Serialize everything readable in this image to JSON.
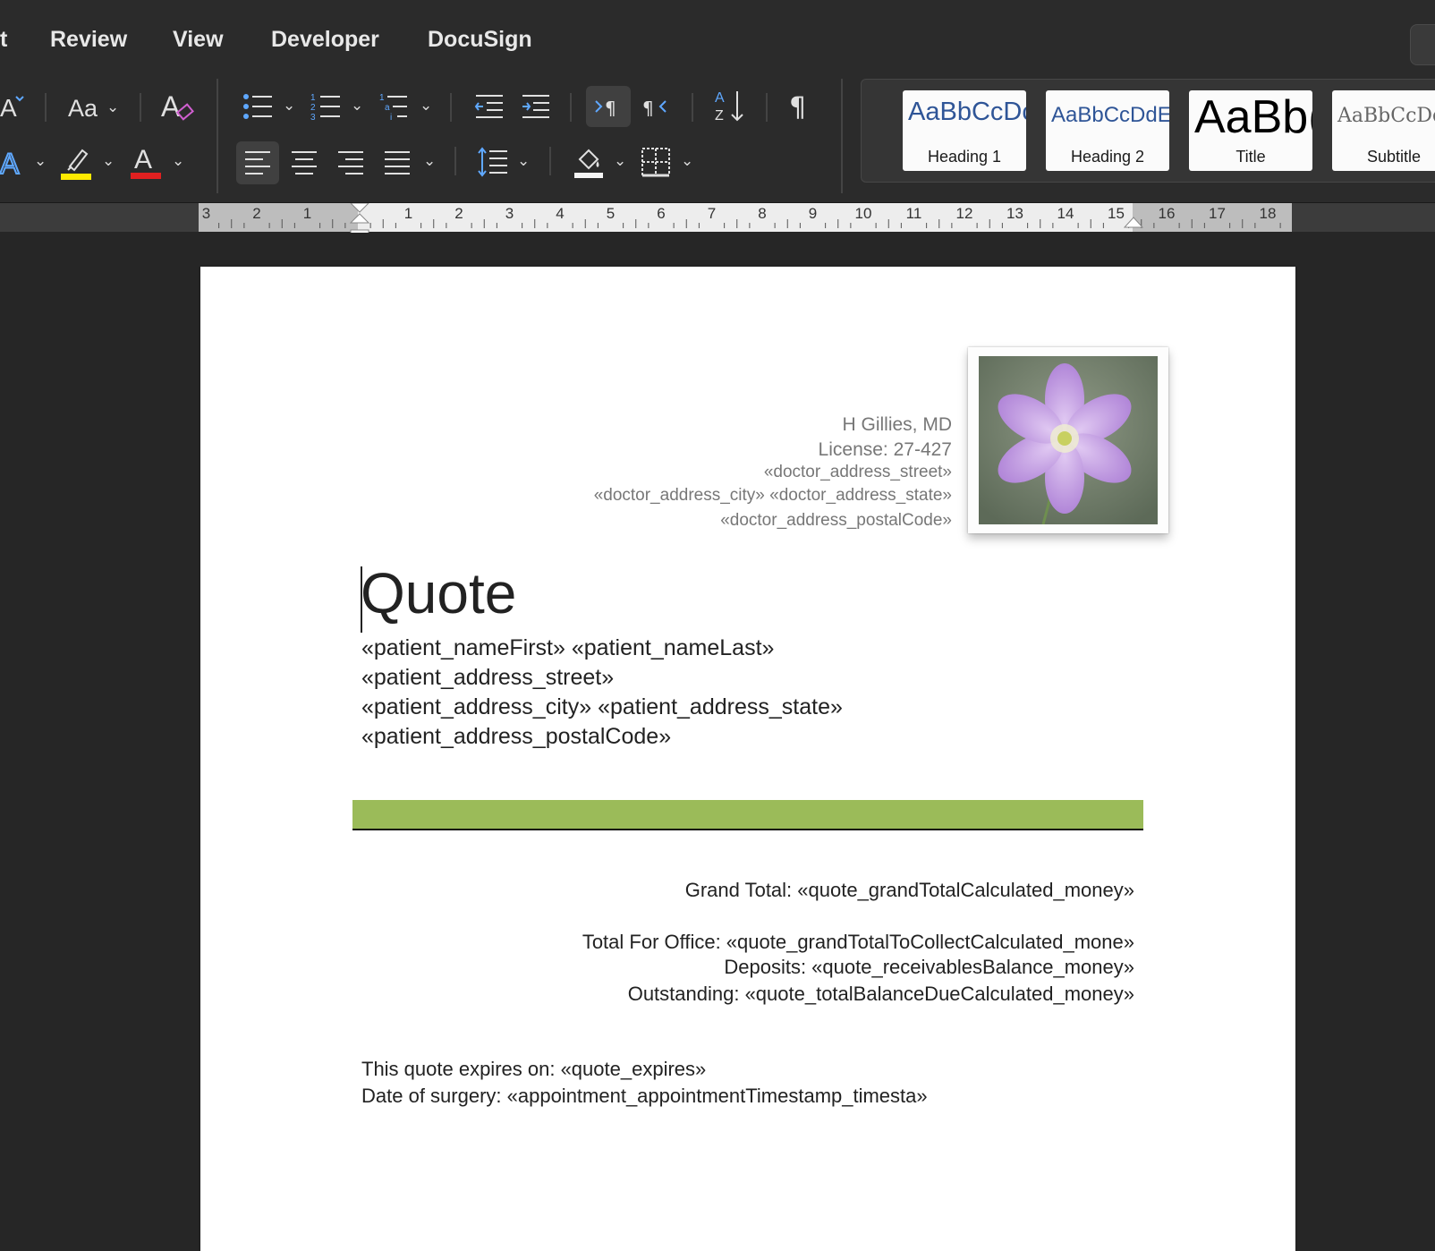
{
  "menu": {
    "tabs": [
      {
        "label": "t"
      },
      {
        "label": "Review"
      },
      {
        "label": "View"
      },
      {
        "label": "Developer"
      },
      {
        "label": "DocuSign"
      }
    ]
  },
  "ribbon": {
    "font_case_label": "Aa",
    "styles": [
      {
        "sample": "AaBbCcDc",
        "label": "Heading 1"
      },
      {
        "sample": "AaBbCcDdEe",
        "label": "Heading 2"
      },
      {
        "sample": "AaBb(",
        "label": "Title"
      },
      {
        "sample": "AaBbCcDd",
        "label": "Subtitle"
      }
    ],
    "highlight_color": "#ffea00",
    "font_color": "#e02020"
  },
  "ruler": {
    "labels": [
      "3",
      "2",
      "1",
      "1",
      "2",
      "3",
      "4",
      "5",
      "6",
      "7",
      "8",
      "9",
      "10",
      "11",
      "12",
      "13",
      "14",
      "15",
      "16",
      "17",
      "18"
    ]
  },
  "document": {
    "doctor": {
      "name": "H Gillies, MD",
      "license": "License: 27-427",
      "street": "«doctor_address_street»",
      "city_state": "«doctor_address_city» «doctor_address_state»",
      "postal": "«doctor_address_postalCode»"
    },
    "title": "Quote",
    "patient": {
      "name": "«patient_nameFirst» «patient_nameLast»",
      "street": "«patient_address_street»",
      "city_state": "«patient_address_city» «patient_address_state»",
      "postal": "«patient_address_postalCode»"
    },
    "accent_color": "#9bbb59",
    "totals": {
      "grand_total": "Grand Total: «quote_grandTotalCalculated_money»",
      "total_for_office": "Total For Office: «quote_grandTotalToCollectCalculated_mone»",
      "deposits": "Deposits: «quote_receivablesBalance_money»",
      "outstanding": "Outstanding: «quote_totalBalanceDueCalculated_money»"
    },
    "expires": "This quote expires on: «quote_expires»",
    "surgery_date": "Date of surgery: «appointment_appointmentTimestamp_timesta»"
  }
}
